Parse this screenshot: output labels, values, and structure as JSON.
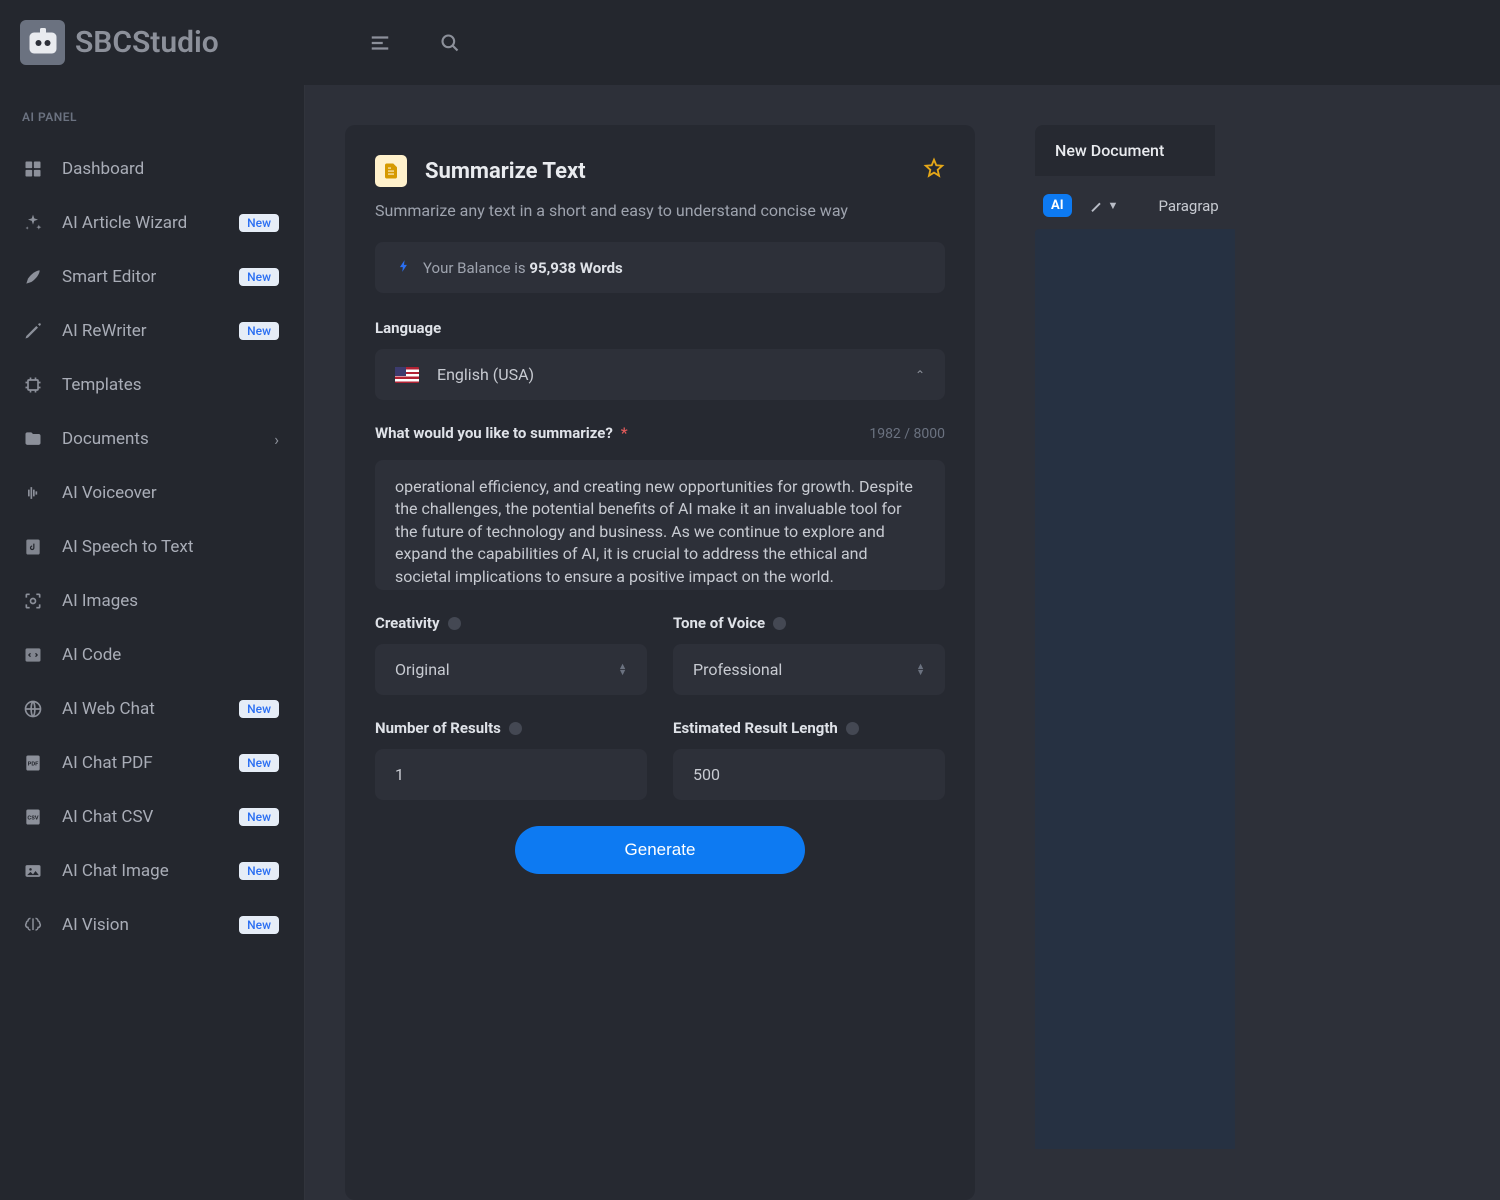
{
  "brand": "SBCStudio",
  "sidebar": {
    "sectionTitle": "AI PANEL",
    "items": [
      {
        "label": "Dashboard",
        "badge": null,
        "chevron": false
      },
      {
        "label": "AI Article Wizard",
        "badge": "New",
        "chevron": false
      },
      {
        "label": "Smart Editor",
        "badge": "New",
        "chevron": false
      },
      {
        "label": "AI ReWriter",
        "badge": "New",
        "chevron": false
      },
      {
        "label": "Templates",
        "badge": null,
        "chevron": false
      },
      {
        "label": "Documents",
        "badge": null,
        "chevron": true
      },
      {
        "label": "AI Voiceover",
        "badge": null,
        "chevron": false
      },
      {
        "label": "AI Speech to Text",
        "badge": null,
        "chevron": false
      },
      {
        "label": "AI Images",
        "badge": null,
        "chevron": false
      },
      {
        "label": "AI Code",
        "badge": null,
        "chevron": false
      },
      {
        "label": "AI Web Chat",
        "badge": "New",
        "chevron": false
      },
      {
        "label": "AI Chat PDF",
        "badge": "New",
        "chevron": false
      },
      {
        "label": "AI Chat CSV",
        "badge": "New",
        "chevron": false
      },
      {
        "label": "AI Chat Image",
        "badge": "New",
        "chevron": false
      },
      {
        "label": "AI Vision",
        "badge": "New",
        "chevron": false
      }
    ]
  },
  "page": {
    "title": "Summarize Text",
    "subtitle": "Summarize any text in a short and easy to understand concise way",
    "balancePrefix": "Your Balance is ",
    "balanceValue": "95,938 Words",
    "labels": {
      "language": "Language",
      "prompt": "What would you like to summarize?",
      "creativity": "Creativity",
      "tone": "Tone of Voice",
      "results": "Number of Results",
      "length": "Estimated Result Length"
    },
    "charCount": "1982 / 8000",
    "values": {
      "language": "English (USA)",
      "promptText": "operational efficiency, and creating new opportunities for growth. Despite the challenges, the potential benefits of AI make it an invaluable tool for the future of technology and business. As we continue to explore and expand the capabilities of AI, it is crucial to address the ethical and societal implications to ensure a positive impact on the world.",
      "creativity": "Original",
      "tone": "Professional",
      "results": "1",
      "length": "500"
    },
    "generateLabel": "Generate"
  },
  "editor": {
    "tab": "New Document",
    "aiBadge": "AI",
    "styleSelector": "Paragrap"
  }
}
